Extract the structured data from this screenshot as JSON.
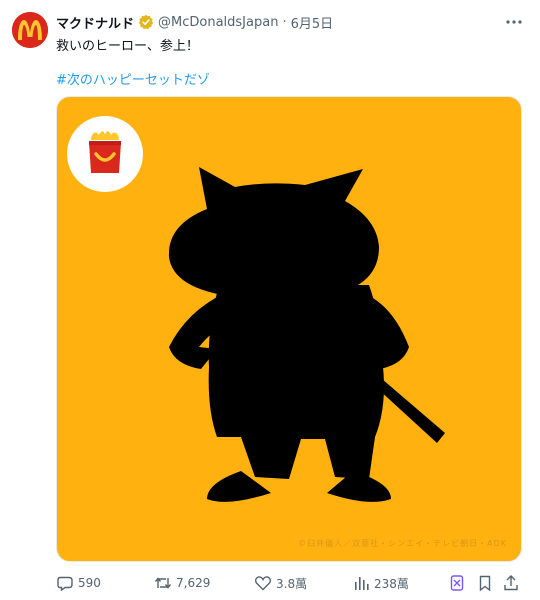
{
  "tweet": {
    "author_name": "マクドナルド",
    "handle": "@McDonaldsJapan",
    "separator": "·",
    "date": "6月5日",
    "text": "救いのヒーロー、参上！",
    "hashtag": "#次のハッピーセットだゾ"
  },
  "media": {
    "background_color": "#ffb20f",
    "watermark": "©臼井儀人／双葉社・シンエイ・テレビ朝日・ADK"
  },
  "actions": {
    "replies": "590",
    "reposts": "7,629",
    "likes": "3.8萬",
    "views": "238萬"
  },
  "icons": [
    "mcdonalds-logo-icon",
    "verified-badge-icon",
    "more-icon",
    "happy-meal-icon",
    "reply-icon",
    "repost-icon",
    "like-icon",
    "views-icon",
    "grok-icon",
    "bookmark-icon",
    "share-icon"
  ],
  "colors": {
    "brand_red": "#da291c",
    "brand_yellow": "#ffc72c",
    "link": "#1d9bf0",
    "secondary_text": "#536471"
  }
}
